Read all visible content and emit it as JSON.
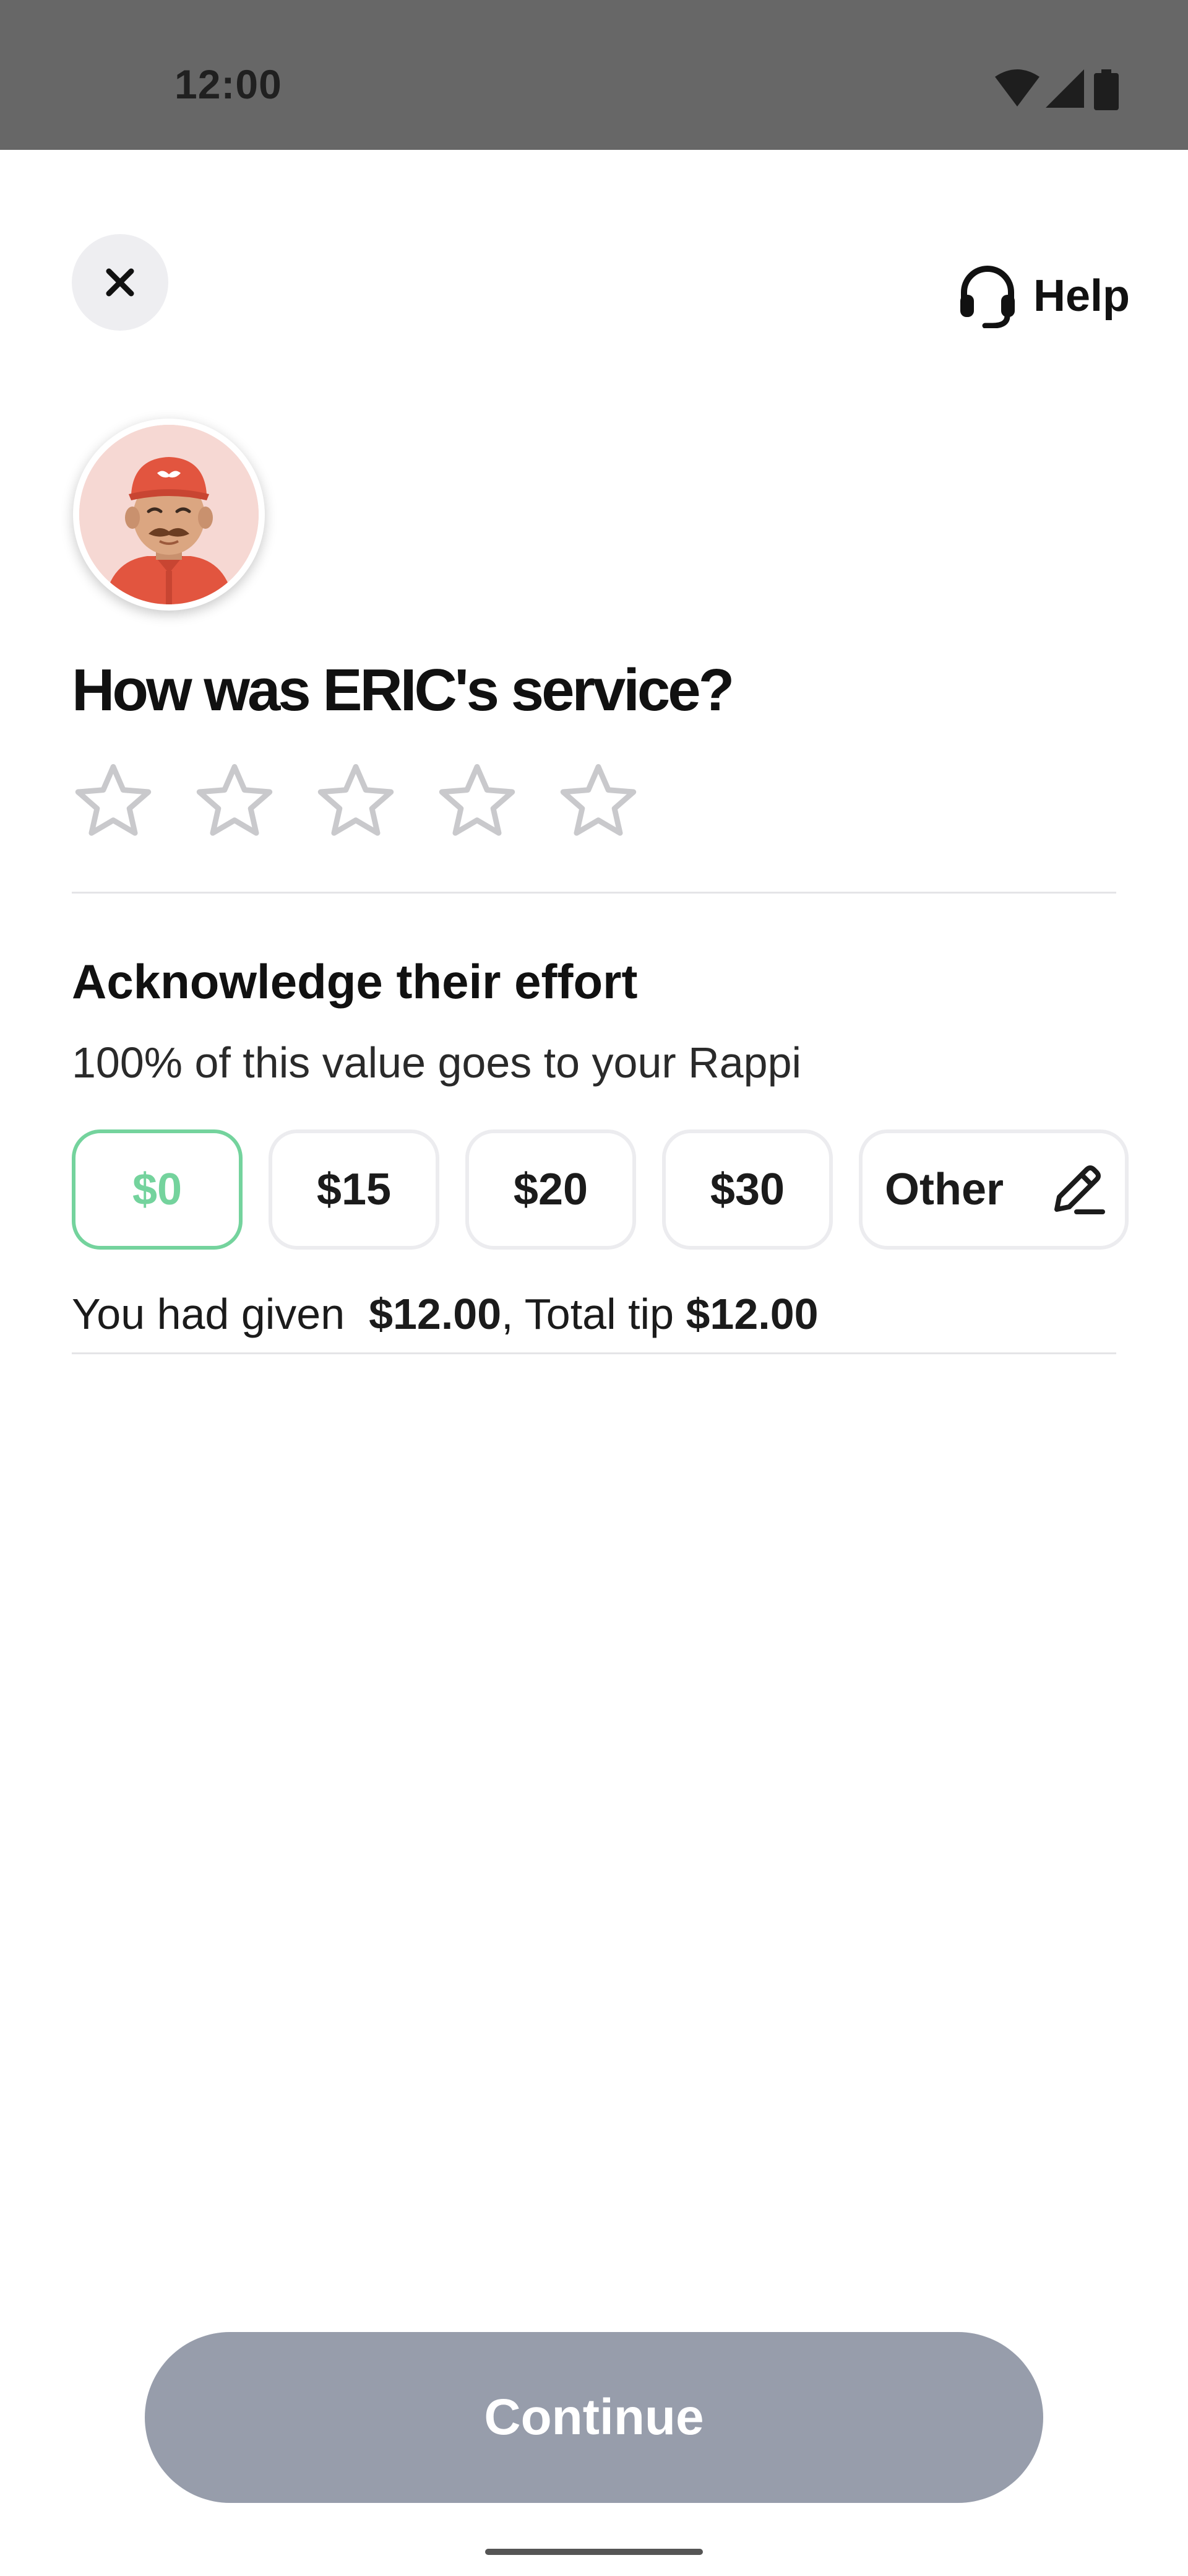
{
  "status_bar": {
    "time": "12:00",
    "icons": [
      "wifi-icon",
      "signal-icon",
      "battery-icon"
    ]
  },
  "header": {
    "close_icon": "close-icon",
    "help_label": "Help",
    "help_icon": "headset-icon"
  },
  "rating": {
    "title": "How was ERIC's service?",
    "stars_total": 5,
    "stars_selected": 0
  },
  "tip": {
    "title": "Acknowledge their effort",
    "subtitle": "100% of this value goes to your Rappi",
    "options": [
      {
        "label": "$0",
        "selected": true
      },
      {
        "label": "$15",
        "selected": false
      },
      {
        "label": "$20",
        "selected": false
      },
      {
        "label": "$30",
        "selected": false
      }
    ],
    "other_label": "Other",
    "other_icon": "pencil-icon",
    "summary_prefix": "You had given ",
    "given_amount": "$12.00",
    "summary_middle": ", Total tip ",
    "total_amount": "$12.00"
  },
  "footer": {
    "continue_label": "Continue"
  },
  "colors": {
    "status_bar": "#676767",
    "selected_accent": "#74d39d",
    "continue_disabled": "#979dab",
    "chip_border": "#ececef",
    "star_outline": "#c9c9cc"
  }
}
